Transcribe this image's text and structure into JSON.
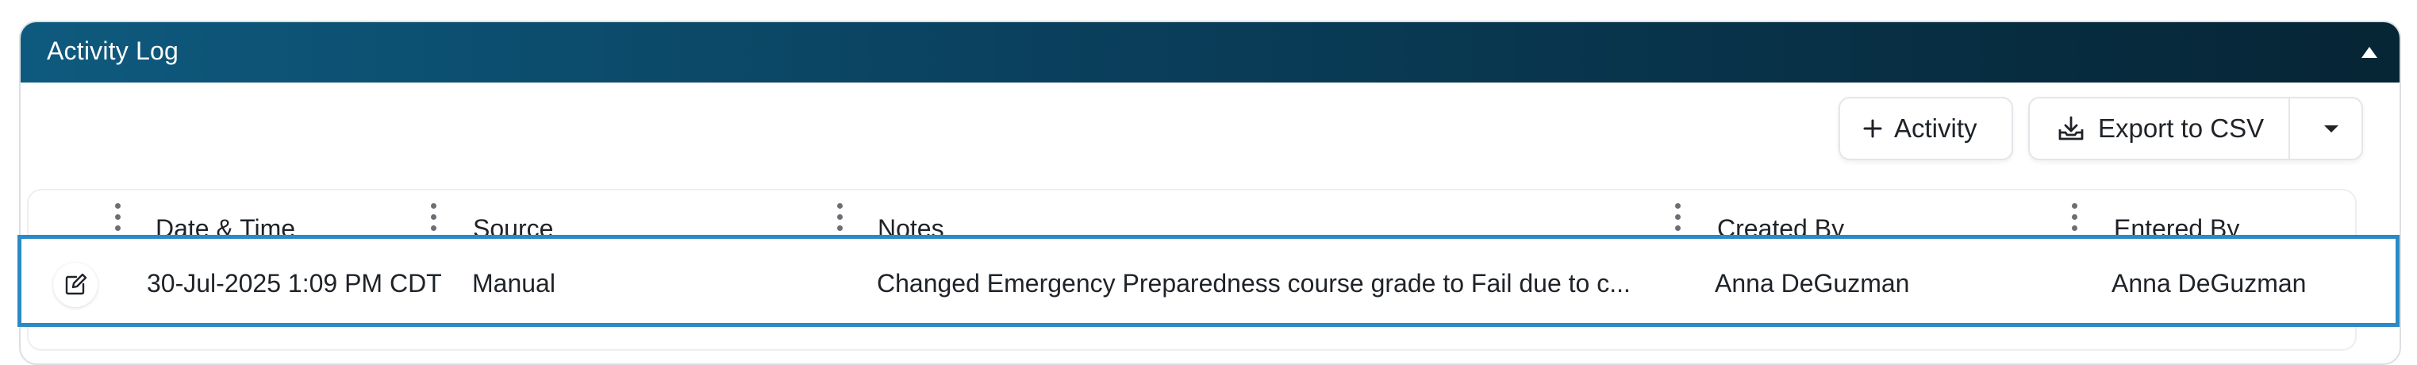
{
  "panel": {
    "title": "Activity Log"
  },
  "toolbar": {
    "add_activity_label": "Activity",
    "export_label": "Export to CSV"
  },
  "table": {
    "columns": [
      "Date & Time",
      "Source",
      "Notes",
      "Created By",
      "Entered By"
    ],
    "rows": [
      {
        "date_time": "30-Jul-2025 1:09 PM CDT",
        "source": "Manual",
        "notes": "Changed Emergency Preparedness course grade to Fail due to c...",
        "created_by": "Anna DeGuzman",
        "entered_by": "Anna DeGuzman"
      }
    ]
  },
  "icons": {
    "collapse": "triangle-up-icon",
    "add": "plus-icon",
    "export": "download-tray-icon",
    "dropdown": "caret-down-icon",
    "column_menu": "kebab-icon",
    "edit": "edit-icon"
  },
  "colors": {
    "header_start": "#0e5a7e",
    "header_end": "#062535",
    "selection": "#2a8ac7"
  }
}
